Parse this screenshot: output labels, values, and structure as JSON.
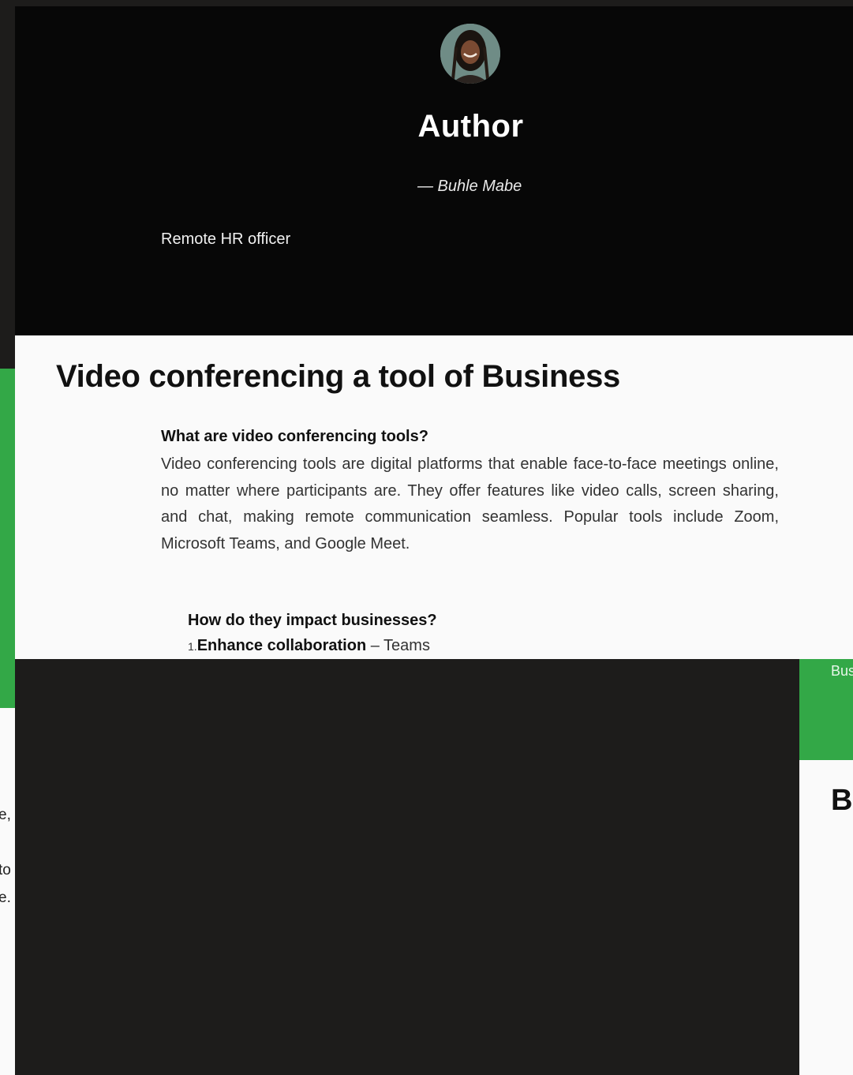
{
  "author": {
    "heading": "Author",
    "name": "— Buhle Mabe",
    "role": "Remote HR officer"
  },
  "article": {
    "title": "Video conferencing a tool of Business",
    "q1": "What are video conferencing tools?",
    "p1": "Video conferencing tools are digital platforms that enable face-to-face meetings online, no matter where participants are. They offer features like video calls, screen sharing, and chat, making remote communication seamless. Popular tools include Zoom, Microsoft Teams, and Google Meet.",
    "q2": "How do they impact businesses?",
    "list": [
      {
        "num": "1.",
        "bold": "Enhance collaboration",
        "rest": " – Teams"
      }
    ]
  },
  "background": {
    "left_fragments": [
      "e,",
      "to",
      "e."
    ],
    "right_label": "Bus",
    "right_heading": "Bi"
  },
  "colors": {
    "accent_green": "#33a847",
    "dark_panel": "#070707",
    "page_bg": "#1d1c1b"
  }
}
